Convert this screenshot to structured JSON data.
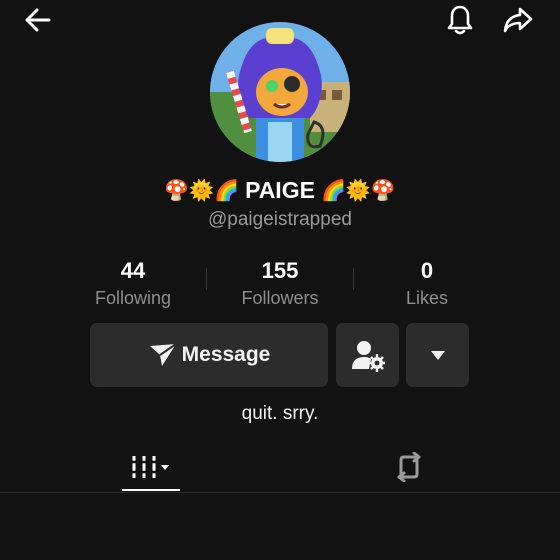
{
  "topbar": {
    "back_icon": "arrow-left-icon",
    "bell_icon": "bell-icon",
    "share_icon": "share-arrow-icon"
  },
  "profile": {
    "avatar_icon": "avatar-illustration",
    "emoji_left": "🍄🌞🌈",
    "name": "PAIGE",
    "emoji_right": "🌈🌞🍄",
    "handle": "@paigeistrapped"
  },
  "stats": [
    {
      "value": "44",
      "label": "Following"
    },
    {
      "value": "155",
      "label": "Followers"
    },
    {
      "value": "0",
      "label": "Likes"
    }
  ],
  "actions": {
    "message_label": "Message",
    "message_icon": "send-icon",
    "friend_settings_icon": "user-gear-icon",
    "more_icon": "caret-down-icon"
  },
  "bio": "quit. srry.",
  "tabs": {
    "videos_icon": "grid-lines-icon",
    "repost_icon": "repost-icon"
  },
  "colors": {
    "background": "#121212",
    "button": "#2c2c2c",
    "muted_text": "#8e8e8e"
  }
}
